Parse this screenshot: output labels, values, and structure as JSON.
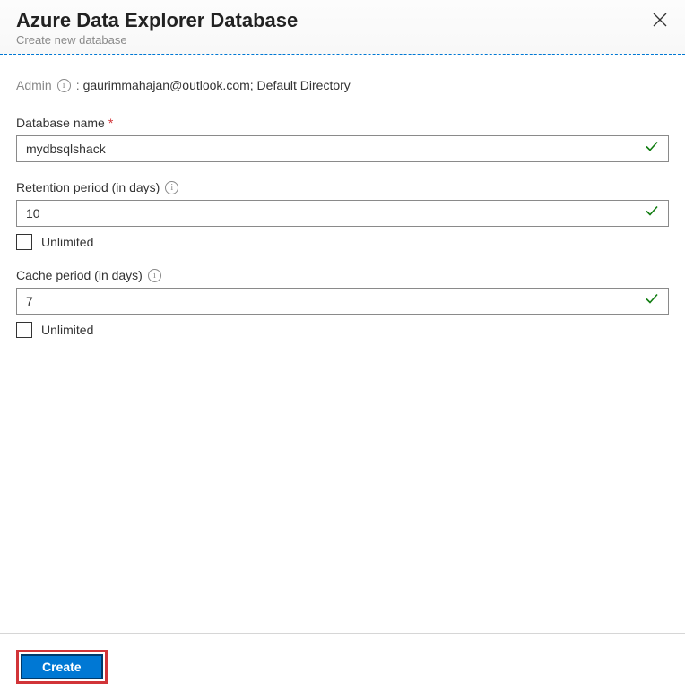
{
  "header": {
    "title": "Azure Data Explorer Database",
    "subtitle": "Create new database"
  },
  "admin": {
    "label": "Admin",
    "separator": ":",
    "value": "gaurimmahajan@outlook.com; Default Directory"
  },
  "fields": {
    "database_name": {
      "label": "Database name",
      "required": true,
      "value": "mydbsqlshack"
    },
    "retention": {
      "label": "Retention period (in days)",
      "value": "10",
      "unlimited_label": "Unlimited"
    },
    "cache": {
      "label": "Cache period (in days)",
      "value": "7",
      "unlimited_label": "Unlimited"
    }
  },
  "footer": {
    "create_label": "Create"
  }
}
